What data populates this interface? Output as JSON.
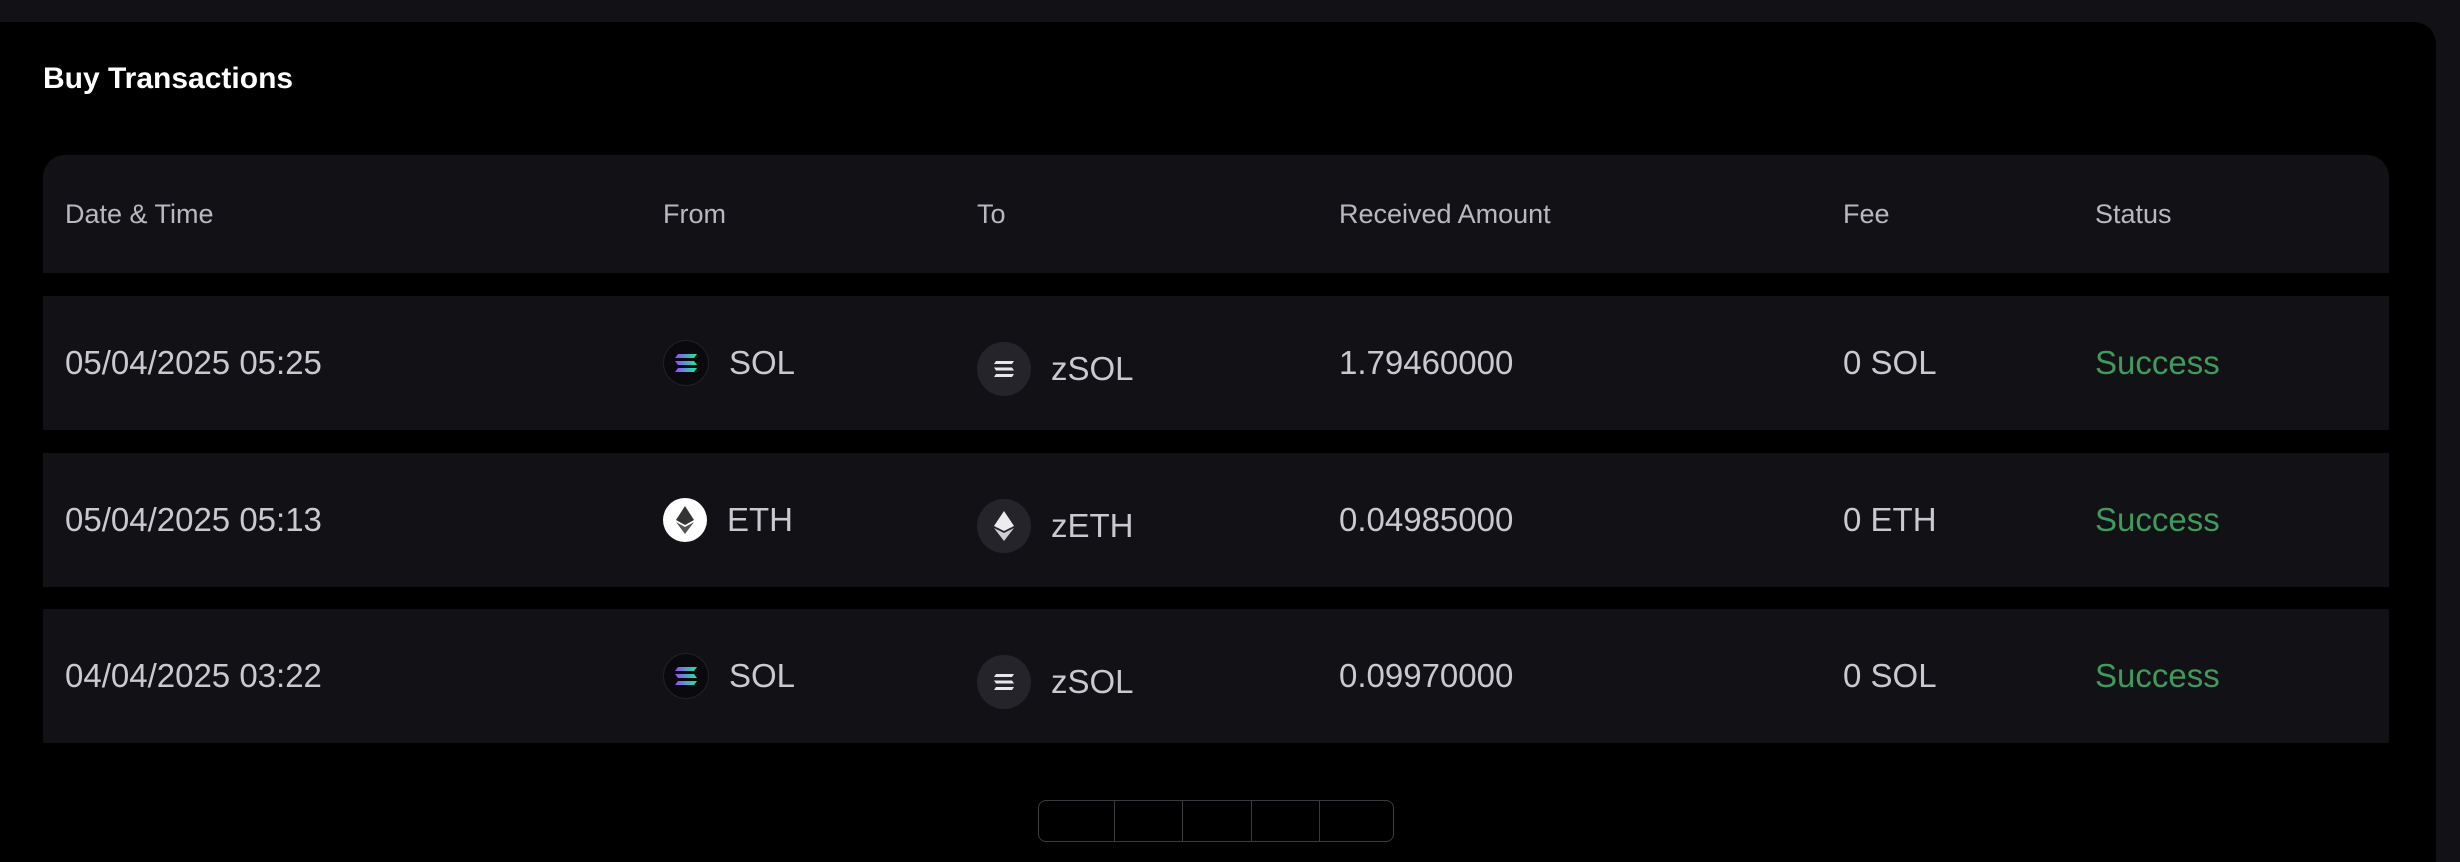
{
  "section_title": "Buy Transactions",
  "columns": {
    "date": "Date & Time",
    "from": "From",
    "to": "To",
    "received": "Received Amount",
    "fee": "Fee",
    "status": "Status"
  },
  "rows": [
    {
      "date": "05/04/2025 05:25",
      "from": "SOL",
      "from_icon": "solana-icon",
      "to": "zSOL",
      "to_icon": "zsol-icon",
      "received": "1.79460000",
      "fee": "0 SOL",
      "status": "Success"
    },
    {
      "date": "05/04/2025 05:13",
      "from": "ETH",
      "from_icon": "ethereum-icon",
      "to": "zETH",
      "to_icon": "zeth-icon",
      "received": "0.04985000",
      "fee": "0 ETH",
      "status": "Success"
    },
    {
      "date": "04/04/2025 03:22",
      "from": "SOL",
      "from_icon": "solana-icon",
      "to": "zSOL",
      "to_icon": "zsol-icon",
      "received": "0.09970000",
      "fee": "0 SOL",
      "status": "Success"
    }
  ],
  "colors": {
    "background": "#000000",
    "row_background": "#121216",
    "header_text": "#b8b8c0",
    "cell_text": "#c9c9d0",
    "success": "#3f9a5c"
  }
}
